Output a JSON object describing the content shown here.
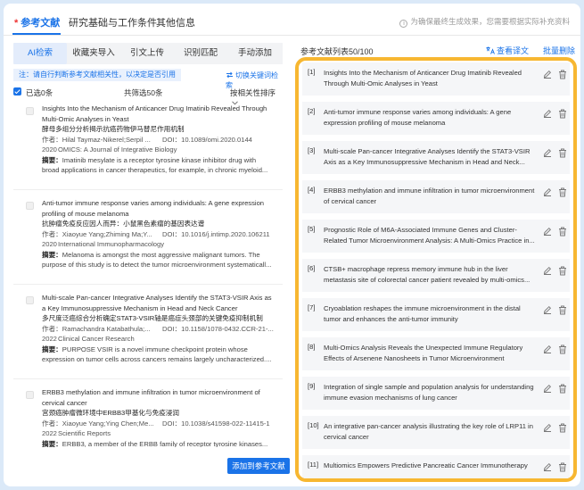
{
  "topbar": {
    "tabs": [
      "参考文献",
      "研究基础与工作条件",
      "其他信息"
    ],
    "required_mark": "*",
    "notice": "为确保最终生成效果，您需要根据实际补充资料"
  },
  "left": {
    "subtabs": [
      "AI检索",
      "收藏夹导入",
      "引文上传",
      "识别匹配",
      "手动添加"
    ],
    "hint": "注：请自行判断参考文献相关性，以决定是否引用",
    "switch_label": "切换关键词检索",
    "selected_label": "已选0条",
    "total_label": "共筛选50条",
    "sort_label": "按相关性排序",
    "add_button": "添加到参考文献",
    "results": [
      {
        "title": "Insights Into the Mechanism of Anticancer Drug Imatinib Revealed Through Multi-Omic Analyses in Yeast",
        "title_cn": "酵母多组分分析揭示抗癌药物伊马替尼作用机制",
        "authors": "作者：Hilal Taymaz-Nikerel;Serpil ...",
        "doi": "DOI：10.1089/omi.2020.0144",
        "year": "2020",
        "journal": "OMICS: A Journal of Integrative Biology",
        "abstract_label": "摘要：",
        "abstract": "Imatinib mesylate is a receptor tyrosine kinase inhibitor drug with broad applications in cancer therapeutics, for example, in chronic myeloid..."
      },
      {
        "title": "Anti-tumor immune response varies among individuals: A gene expression profiling of mouse melanoma",
        "title_cn": "抗肿瘤免疫反应因人而异：小鼠黑色素瘤的基因表达谱",
        "authors": "作者：Xiaoyue Yang;Zhiming Ma;Y...",
        "doi": "DOI：10.1016/j.intimp.2020.106211",
        "year": "2020",
        "journal": "International Immunopharmacology",
        "abstract_label": "摘要：",
        "abstract": "Melanoma is amongst the most aggressive malignant tumors. The purpose of this study is to detect the tumor microenvironment systematicall..."
      },
      {
        "title": "Multi-scale Pan-cancer Integrative Analyses Identify the STAT3-VSIR Axis as a Key Immunosuppressive Mechanism in Head and Neck Cancer",
        "title_cn": "多尺度泛癌综合分析确定STAT3-VSIR轴是癌症头颈部的关键免疫抑制机制",
        "authors": "作者：Ramachandra Katabathula;...",
        "doi": "DOI：10.1158/1078-0432.CCR-21-...",
        "year": "2022",
        "journal": "Clinical Cancer Research",
        "abstract_label": "摘要：",
        "abstract": "PURPOSE VSIR is a novel immune checkpoint protein whose expression on tumor cells across cancers remains largely uncharacterized...."
      },
      {
        "title": "ERBB3 methylation and immune infiltration in tumor microenvironment of cervical cancer",
        "title_cn": "宫颈癌肿瘤微环境中ERBB3甲基化与免疫浸润",
        "authors": "作者：Xiaoyue Yang;Ying Chen;Me...",
        "doi": "DOI：10.1038/s41598-022-11415-1",
        "year": "2022",
        "journal": "Scientific Reports",
        "abstract_label": "摘要：",
        "abstract": "ERBB3, a member of the ERBB family of receptor tyrosine kinases..."
      }
    ]
  },
  "right": {
    "header": "参考文献列表50/100",
    "view_label": "查看译文",
    "delete_label": "批量删除",
    "refs": [
      {
        "num": "[1]",
        "title": "Insights Into the Mechanism of Anticancer Drug Imatinib Revealed Through Multi-Omic Analyses in Yeast"
      },
      {
        "num": "[2]",
        "title": "Anti-tumor immune response varies among individuals: A gene expression profiling of mouse melanoma"
      },
      {
        "num": "[3]",
        "title": "Multi-scale Pan-cancer Integrative Analyses Identify the STAT3-VSIR Axis as a Key Immunosuppressive Mechanism in Head and Neck..."
      },
      {
        "num": "[4]",
        "title": "ERBB3 methylation and immune infiltration in tumor microenvironment of cervical cancer"
      },
      {
        "num": "[5]",
        "title": "Prognostic Role of M6A-Associated Immune Genes and Cluster-Related Tumor Microenvironment Analysis: A Multi-Omics Practice in..."
      },
      {
        "num": "[6]",
        "title": "CTSB+ macrophage repress memory immune hub in the liver metastasis site of colorectal cancer patient revealed by multi-omics..."
      },
      {
        "num": "[7]",
        "title": "Cryoablation reshapes the immune microenvironment in the distal tumor and enhances the anti-tumor immunity"
      },
      {
        "num": "[8]",
        "title": "Multi-Omics Analysis Reveals the Unexpected Immune Regulatory Effects of Arsenene Nanosheets in Tumor Microenvironment"
      },
      {
        "num": "[9]",
        "title": "Integration of single sample and population analysis for understanding immune evasion mechanisms of lung cancer"
      },
      {
        "num": "[10]",
        "title": "An integrative pan-cancer analysis illustrating the key role of LRP11 in cervical cancer"
      },
      {
        "num": "[11]",
        "title": "Multiomics Empowers Predictive Pancreatic Cancer Immunotherapy"
      }
    ]
  },
  "colors": {
    "accent": "#1a73e8",
    "highlight_border": "#f7b731",
    "required": "#e33333"
  },
  "icons": [
    "info-icon",
    "switch-icon",
    "chevron-down-icon",
    "translate-icon",
    "edit-icon",
    "trash-icon",
    "checkbox-icon"
  ]
}
